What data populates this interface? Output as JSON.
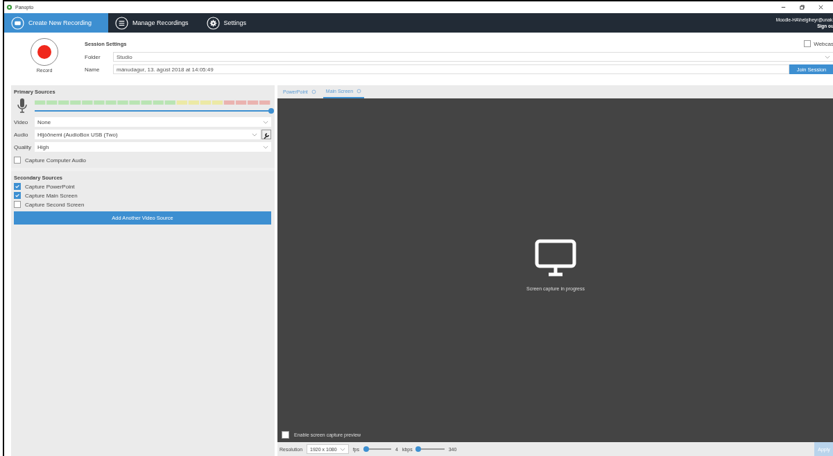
{
  "window": {
    "title": "Panopto"
  },
  "nav": {
    "tabs": [
      {
        "label": "Create New Recording",
        "selected": true
      },
      {
        "label": "Manage Recordings",
        "selected": false
      },
      {
        "label": "Settings",
        "selected": false
      }
    ],
    "user": "Moodle-HA\\helgiheyr@unak.",
    "sign_out": "Sign ou"
  },
  "session": {
    "record_label": "Record",
    "title": "Session Settings",
    "folder": {
      "label": "Folder",
      "value": "Studio"
    },
    "name": {
      "label": "Name",
      "value": "mánudagur, 13. ágúst 2018 at 14:05:49"
    },
    "webcast": {
      "label": "Webcas",
      "checked": false
    },
    "join_button": "Join Session"
  },
  "primary": {
    "title": "Primary Sources",
    "volume": {
      "level": 1
    },
    "fields": [
      {
        "label": "Video",
        "value": "None",
        "tool": false
      },
      {
        "label": "Audio",
        "value": "Hljóðnemi (AudioBox USB (Two)",
        "tool": true
      },
      {
        "label": "Quality",
        "value": "High",
        "tool": false
      }
    ],
    "capture_audio": {
      "label": "Capture Computer Audio",
      "checked": false
    }
  },
  "secondary": {
    "title": "Secondary Sources",
    "items": [
      {
        "label": "Capture PowerPoint",
        "checked": true
      },
      {
        "label": "Capture Main Screen",
        "checked": true
      },
      {
        "label": "Capture Second Screen",
        "checked": false
      }
    ],
    "add_button": "Add Another Video Source"
  },
  "preview": {
    "tabs": [
      {
        "label": "PowerPoint",
        "selected": false
      },
      {
        "label": "Main Screen",
        "selected": true
      }
    ],
    "message": "Screen capture in progress",
    "enable_preview": {
      "label": "Enable screen capture preview",
      "checked": false
    }
  },
  "bottom": {
    "resolution_label": "Resolution",
    "resolution": "1920 x 1080",
    "fps_label": "fps",
    "fps": {
      "level": 0.1
    },
    "fps_value": "4",
    "kbps_label": "kbps",
    "kbps": {
      "level": 0.06
    },
    "kbps_value": "340",
    "apply": "Apply"
  }
}
